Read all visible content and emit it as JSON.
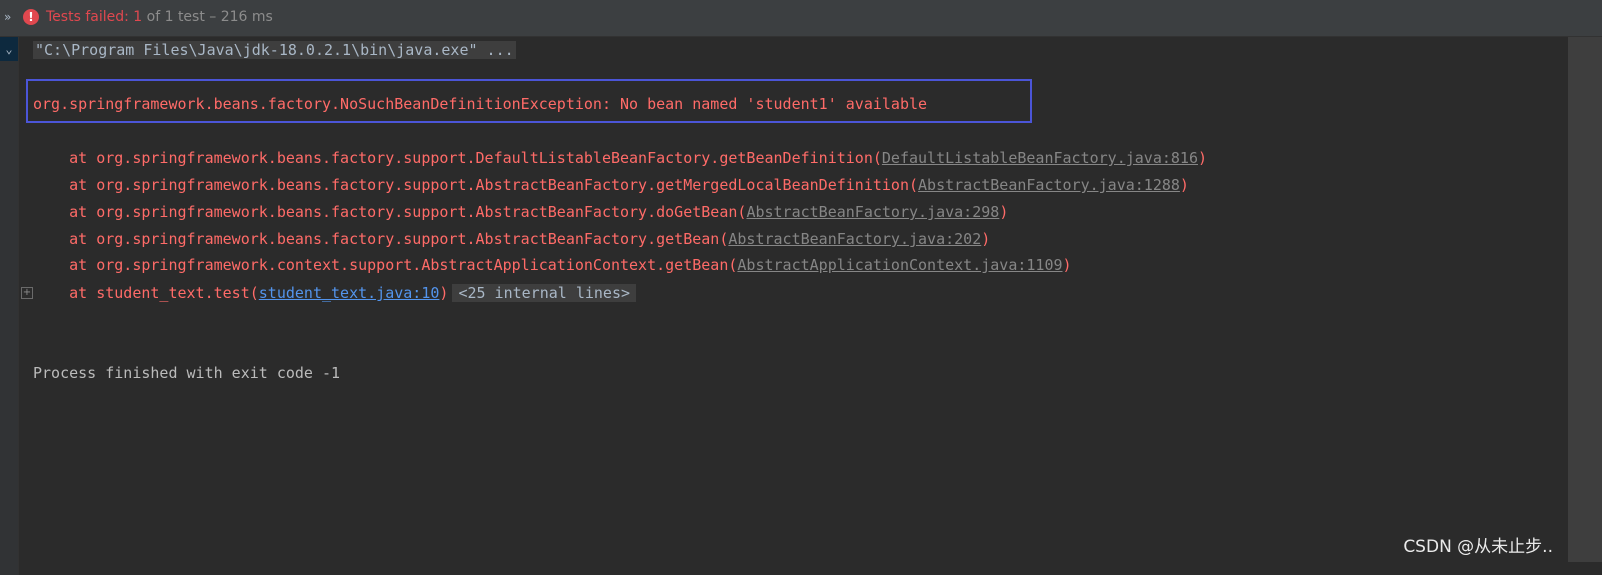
{
  "header": {
    "expand_icon": "double-chevron-right-icon",
    "fail_icon": "exclamation-circle-icon",
    "failed_label": "Tests failed: 1",
    "summary": " of 1 test – 216 ms"
  },
  "console": {
    "command": "\"C:\\Program Files\\Java\\jdk-18.0.2.1\\bin\\java.exe\" ...",
    "exception": "org.springframework.beans.factory.NoSuchBeanDefinitionException: No bean named 'student1' available",
    "stack": [
      {
        "prefix": "    at org.springframework.beans.factory.support.DefaultListableBeanFactory.getBeanDefinition(",
        "link": "DefaultListableBeanFactory.java:816",
        "suffix": ")"
      },
      {
        "prefix": "    at org.springframework.beans.factory.support.AbstractBeanFactory.getMergedLocalBeanDefinition(",
        "link": "AbstractBeanFactory.java:1288",
        "suffix": ")"
      },
      {
        "prefix": "    at org.springframework.beans.factory.support.AbstractBeanFactory.doGetBean(",
        "link": "AbstractBeanFactory.java:298",
        "suffix": ")"
      },
      {
        "prefix": "    at org.springframework.beans.factory.support.AbstractBeanFactory.getBean(",
        "link": "AbstractBeanFactory.java:202",
        "suffix": ")"
      },
      {
        "prefix": "    at org.springframework.context.support.AbstractApplicationContext.getBean(",
        "link": "AbstractApplicationContext.java:1109",
        "suffix": ")"
      }
    ],
    "last_frame": {
      "prefix": "    at student_text.test(",
      "link": "student_text.java:10",
      "suffix": ")",
      "internal": "<25 internal lines>"
    },
    "exit": "Process finished with exit code -1"
  },
  "watermark": "CSDN @从未止步.."
}
